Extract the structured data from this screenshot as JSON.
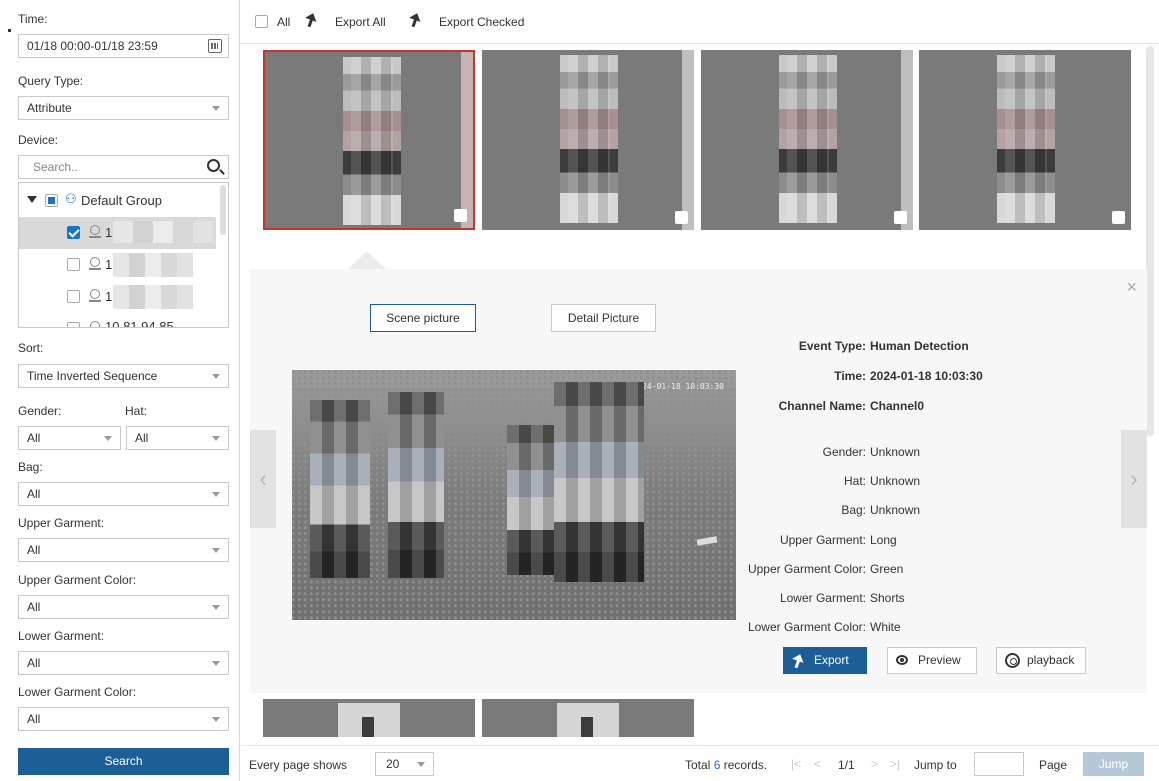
{
  "filters": {
    "time_label": "Time:",
    "time_value": "01/18 00:00-01/18 23:59",
    "query_type_label": "Query Type:",
    "query_type_value": "Attribute",
    "device_label": "Device:",
    "device_search_placeholder": "Search..",
    "tree": {
      "group": "Default Group",
      "devices": [
        "1",
        "1",
        "1",
        "10.81.94.85"
      ]
    },
    "sort_label": "Sort:",
    "sort_value": "Time Inverted Sequence",
    "gender_label": "Gender:",
    "gender_value": "All",
    "hat_label": "Hat:",
    "hat_value": "All",
    "bag_label": "Bag:",
    "bag_value": "All",
    "upper_garment_label": "Upper Garment:",
    "upper_garment_value": "All",
    "upper_color_label": "Upper Garment Color:",
    "upper_color_value": "All",
    "lower_garment_label": "Lower Garment:",
    "lower_garment_value": "All",
    "lower_color_label": "Lower Garment Color:",
    "lower_color_value": "All",
    "search_button": "Search"
  },
  "toolbar": {
    "all_label": "All",
    "export_all": "Export All",
    "export_checked": "Export Checked"
  },
  "detail": {
    "tab_scene": "Scene picture",
    "tab_detail": "Detail Picture",
    "close": "×",
    "prev": "‹",
    "next": "›",
    "scene_timestamp": "2024-01-18 10:03:30",
    "fields": [
      {
        "key": "Event Type:",
        "value": "Human Detection",
        "bold": true
      },
      {
        "key": "Time:",
        "value": "2024-01-18 10:03:30",
        "bold": true
      },
      {
        "key": "Channel Name:",
        "value": "Channel0",
        "bold": true
      },
      {
        "key": "Gender:",
        "value": "Unknown",
        "bold": false
      },
      {
        "key": "Hat:",
        "value": "Unknown",
        "bold": false
      },
      {
        "key": "Bag:",
        "value": "Unknown",
        "bold": false
      },
      {
        "key": "Upper Garment:",
        "value": "Long",
        "bold": false
      },
      {
        "key": "Upper Garment Color:",
        "value": "Green",
        "bold": false
      },
      {
        "key": "Lower Garment:",
        "value": "Shorts",
        "bold": false
      },
      {
        "key": "Lower Garment Color:",
        "value": "White",
        "bold": false
      }
    ],
    "export_button": "Export",
    "preview_button": "Preview",
    "playback_button": "playback"
  },
  "pager": {
    "every_page_shows": "Every page shows",
    "page_size": "20",
    "total_prefix": "Total",
    "total_count": "6",
    "total_suffix": "records.",
    "first": "|<",
    "prev": "<",
    "page_indicator": "1/1",
    "next": ">",
    "last": ">|",
    "jump_to": "Jump to",
    "page": "Page",
    "jump_button": "Jump"
  },
  "colors": {
    "accent": "#1c5e96",
    "selected_border": "#c0392b",
    "link_count": "#1a73c9"
  }
}
